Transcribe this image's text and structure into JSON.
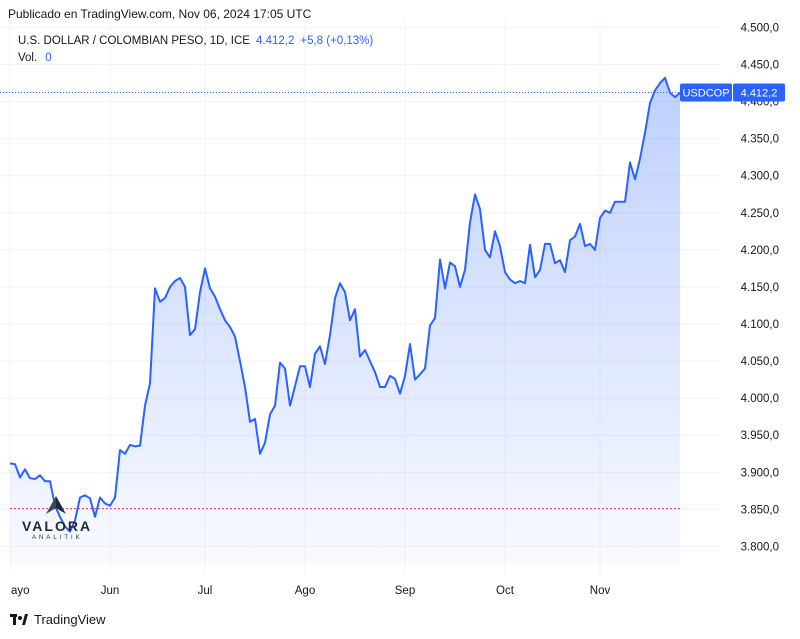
{
  "header": {
    "published": "Publicado en TradingView.com, Nov 06, 2024 17:05 UTC"
  },
  "legend": {
    "symbol": "U.S. DOLLAR / COLOMBIAN PESO, 1D, ICE",
    "last": "4.412,2",
    "change": "+5,8 (+0,13%)",
    "vol_label": "Vol.",
    "vol_value": "0"
  },
  "price_tag": {
    "ticker": "USDCOP",
    "value": "4.412,2"
  },
  "footer": {
    "brand": "TradingView"
  },
  "logo": {
    "name": "VALORA",
    "sub": "ANALITIK"
  },
  "colors": {
    "line": "#2962ff",
    "fill": "#2962ff",
    "grid": "#f0f3fa",
    "prev_close": "#f23645",
    "tag_bg": "#2962ff"
  },
  "chart_data": {
    "type": "area",
    "title": "U.S. DOLLAR / COLOMBIAN PESO, 1D, ICE",
    "x_ticks": [
      {
        "label": "ayo",
        "t": 0
      },
      {
        "label": "Jun",
        "t": 20
      },
      {
        "label": "Jul",
        "t": 39
      },
      {
        "label": "Ago",
        "t": 59
      },
      {
        "label": "Sep",
        "t": 79
      },
      {
        "label": "Oct",
        "t": 99
      },
      {
        "label": "Nov",
        "t": 118
      }
    ],
    "y_ticks": [
      {
        "label": "3.800,0",
        "v": 3800
      },
      {
        "label": "3.850,0",
        "v": 3850
      },
      {
        "label": "3.900,0",
        "v": 3900
      },
      {
        "label": "3.950,0",
        "v": 3950
      },
      {
        "label": "4.000,0",
        "v": 4000
      },
      {
        "label": "4.050,0",
        "v": 4050
      },
      {
        "label": "4.100,0",
        "v": 4100
      },
      {
        "label": "4.150,0",
        "v": 4150
      },
      {
        "label": "4.200,0",
        "v": 4200
      },
      {
        "label": "4.250,0",
        "v": 4250
      },
      {
        "label": "4.300,0",
        "v": 4300
      },
      {
        "label": "4.350,0",
        "v": 4350
      },
      {
        "label": "4.400,0",
        "v": 4400
      },
      {
        "label": "4.450,0",
        "v": 4450
      },
      {
        "label": "4.500,0",
        "v": 4500
      }
    ],
    "ylim": [
      3775,
      4510
    ],
    "last_price": 4412.2,
    "prev_close_line": 3851,
    "grid": true,
    "values": [
      3912,
      3911,
      3893,
      3904,
      3892,
      3891,
      3896,
      3888,
      3888,
      3855,
      3840,
      3827,
      3820,
      3835,
      3866,
      3869,
      3865,
      3840,
      3866,
      3858,
      3855,
      3866,
      3930,
      3925,
      3937,
      3935,
      3936,
      3990,
      4020,
      4148,
      4130,
      4135,
      4150,
      4158,
      4162,
      4150,
      4085,
      4093,
      4143,
      4175,
      4148,
      4137,
      4120,
      4105,
      4096,
      4083,
      4050,
      4015,
      3968,
      3972,
      3925,
      3940,
      3978,
      3990,
      4048,
      4040,
      3990,
      4016,
      4043,
      4043,
      4015,
      4060,
      4070,
      4046,
      4085,
      4135,
      4155,
      4143,
      4105,
      4120,
      4056,
      4065,
      4050,
      4035,
      4015,
      4015,
      4030,
      4026,
      4006,
      4030,
      4073,
      4025,
      4032,
      4040,
      4098,
      4108,
      4187,
      4148,
      4183,
      4178,
      4150,
      4173,
      4237,
      4275,
      4255,
      4200,
      4190,
      4225,
      4205,
      4170,
      4160,
      4155,
      4158,
      4155,
      4207,
      4163,
      4173,
      4208,
      4208,
      4182,
      4186,
      4170,
      4213,
      4218,
      4235,
      4205,
      4208,
      4200,
      4243,
      4253,
      4250,
      4265,
      4265,
      4265,
      4318,
      4295,
      4323,
      4358,
      4398,
      4415,
      4425,
      4432,
      4412,
      4406,
      4412
    ]
  }
}
